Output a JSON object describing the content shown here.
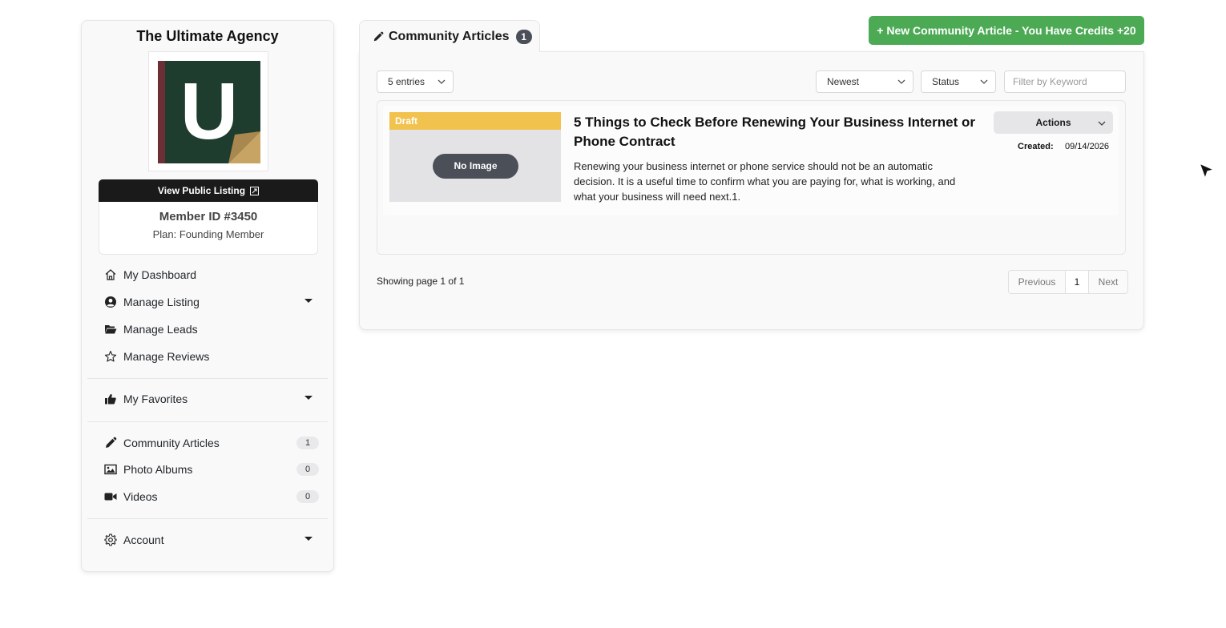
{
  "sidebar": {
    "agency_name": "The Ultimate Agency",
    "logo_letter": "U",
    "view_listing_label": "View Public Listing",
    "member_id": "Member ID #3450",
    "plan": "Plan: Founding Member",
    "nav": {
      "dashboard": "My Dashboard",
      "manage_listing": "Manage Listing",
      "manage_leads": "Manage Leads",
      "manage_reviews": "Manage Reviews",
      "favorites": "My Favorites",
      "community_articles": {
        "label": "Community Articles",
        "count": "1"
      },
      "photo_albums": {
        "label": "Photo Albums",
        "count": "0"
      },
      "videos": {
        "label": "Videos",
        "count": "0"
      },
      "account": "Account"
    }
  },
  "main": {
    "tab": {
      "label": "Community Articles",
      "count": "1"
    },
    "new_article_label": "+ New Community Article - You Have Credits +20",
    "filters": {
      "entries": "5 entries",
      "sort": "Newest",
      "status": "Status",
      "keyword_placeholder": "Filter by Keyword"
    },
    "articles": [
      {
        "status": "Draft",
        "image_placeholder": "No Image",
        "title": "5 Things to Check Before Renewing Your Business Internet or Phone Contract",
        "excerpt": "Renewing your business internet or phone service should not be an automatic decision. It is a useful time to confirm what you are paying for, what is working, and what your business will need next.1.",
        "actions_label": "Actions",
        "created_label": "Created:",
        "created_value": "09/14/2026"
      }
    ],
    "pagination": {
      "info": "Showing page 1 of 1",
      "previous": "Previous",
      "page": "1",
      "next": "Next"
    }
  },
  "colors": {
    "primary_green": "#4caa55",
    "draft_yellow": "#f2c24e",
    "logo_green": "#1e3d2f",
    "badge_dark": "#4a4f58"
  }
}
